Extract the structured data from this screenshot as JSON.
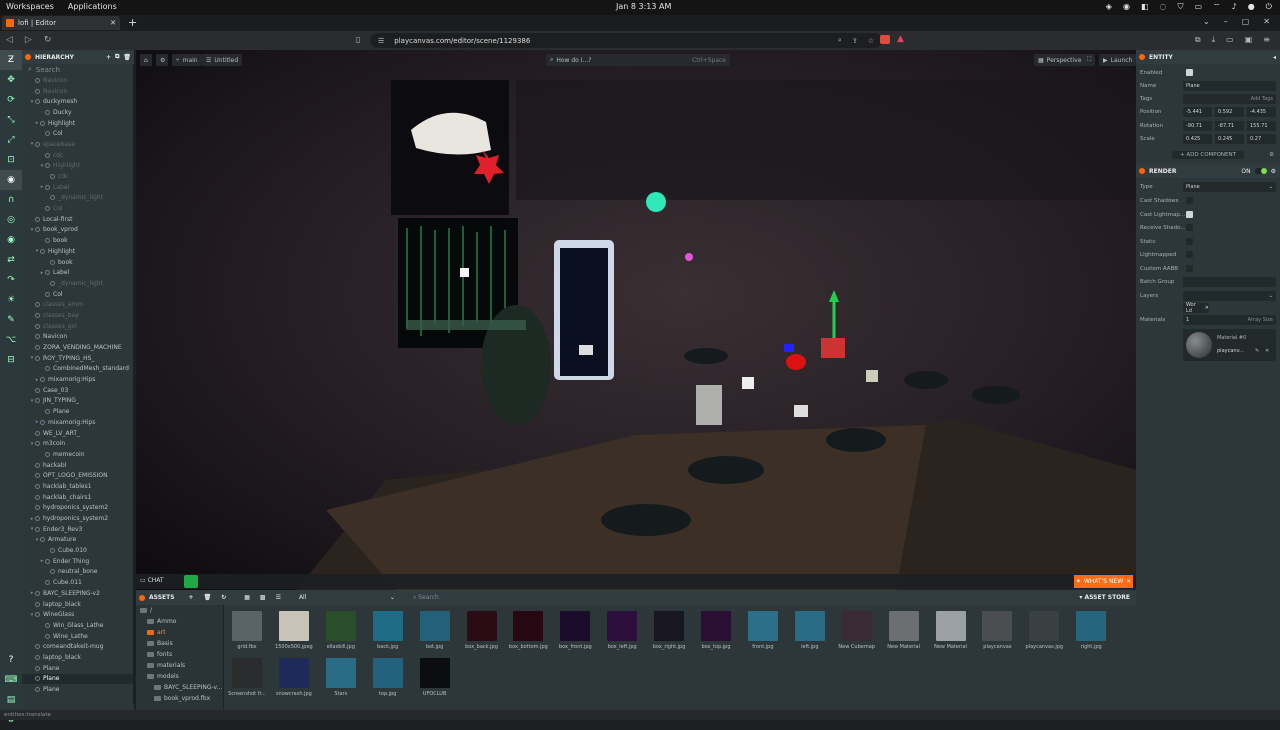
{
  "os": {
    "workspaces": "Workspaces",
    "applications": "Applications",
    "clock": "Jan 8   3:13 AM"
  },
  "browser": {
    "tab_title": "lofi | Editor",
    "url": "playcanvas.com/editor/scene/1129386"
  },
  "toolbar": {
    "branch": "main",
    "scene": "Untitled",
    "howdoi": "How do I...?",
    "howdoi_hint": "Ctrl+Space",
    "perspective": "Perspective",
    "launch": "Launch"
  },
  "hierarchy": {
    "title": "HIERARCHY",
    "search_placeholder": "Search",
    "rows": [
      {
        "label": "Navicon",
        "indent": 1,
        "dim": true,
        "toggle": ""
      },
      {
        "label": "Navicon",
        "indent": 1,
        "dim": true,
        "toggle": ""
      },
      {
        "label": "duckymesh",
        "indent": 1,
        "dim": false,
        "toggle": "-"
      },
      {
        "label": "Ducky",
        "indent": 3,
        "dim": false,
        "toggle": ""
      },
      {
        "label": "Highlight",
        "indent": 2,
        "dim": false,
        "toggle": "+"
      },
      {
        "label": "Col",
        "indent": 3,
        "dim": false,
        "toggle": ""
      },
      {
        "label": "spacebase",
        "indent": 1,
        "dim": true,
        "toggle": "-"
      },
      {
        "label": "cdc",
        "indent": 3,
        "dim": true,
        "toggle": ""
      },
      {
        "label": "Highlight",
        "indent": 3,
        "dim": true,
        "toggle": "-"
      },
      {
        "label": "cdc",
        "indent": 4,
        "dim": true,
        "toggle": ""
      },
      {
        "label": "Label",
        "indent": 3,
        "dim": true,
        "toggle": "+"
      },
      {
        "label": "_dynamic_light",
        "indent": 4,
        "dim": true,
        "toggle": ""
      },
      {
        "label": "Col",
        "indent": 3,
        "dim": true,
        "toggle": ""
      },
      {
        "label": "Local-first",
        "indent": 1,
        "dim": false,
        "toggle": ""
      },
      {
        "label": "book_vprod",
        "indent": 1,
        "dim": false,
        "toggle": "-"
      },
      {
        "label": "book",
        "indent": 3,
        "dim": false,
        "toggle": ""
      },
      {
        "label": "Highlight",
        "indent": 2,
        "dim": false,
        "toggle": "-"
      },
      {
        "label": "book",
        "indent": 4,
        "dim": false,
        "toggle": ""
      },
      {
        "label": "Label",
        "indent": 3,
        "dim": false,
        "toggle": "+"
      },
      {
        "label": "_dynamic_light",
        "indent": 4,
        "dim": true,
        "toggle": ""
      },
      {
        "label": "Col",
        "indent": 3,
        "dim": false,
        "toggle": ""
      },
      {
        "label": "classes_amm",
        "indent": 1,
        "dim": true,
        "toggle": ""
      },
      {
        "label": "classes_bay",
        "indent": 1,
        "dim": true,
        "toggle": ""
      },
      {
        "label": "classes_gol",
        "indent": 1,
        "dim": true,
        "toggle": ""
      },
      {
        "label": "Navicon",
        "indent": 1,
        "dim": false,
        "toggle": ""
      },
      {
        "label": "ZORA_VENDING_MACHINE",
        "indent": 1,
        "dim": false,
        "toggle": ""
      },
      {
        "label": "ROY_TYPING_HS_",
        "indent": 1,
        "dim": false,
        "toggle": "-"
      },
      {
        "label": "CombinedMesh_standard",
        "indent": 3,
        "dim": false,
        "toggle": ""
      },
      {
        "label": "mixamorig:Hips",
        "indent": 2,
        "dim": false,
        "toggle": "+"
      },
      {
        "label": "Case_03",
        "indent": 1,
        "dim": false,
        "toggle": ""
      },
      {
        "label": "JIN_TYPING_",
        "indent": 1,
        "dim": false,
        "toggle": "-"
      },
      {
        "label": "Plane",
        "indent": 3,
        "dim": false,
        "toggle": ""
      },
      {
        "label": "mixamorig:Hips",
        "indent": 2,
        "dim": false,
        "toggle": "+"
      },
      {
        "label": "WE_LV_ART_",
        "indent": 1,
        "dim": false,
        "toggle": ""
      },
      {
        "label": "m3coin",
        "indent": 1,
        "dim": false,
        "toggle": "-"
      },
      {
        "label": "memecoin",
        "indent": 3,
        "dim": false,
        "toggle": ""
      },
      {
        "label": "hackabl",
        "indent": 1,
        "dim": false,
        "toggle": ""
      },
      {
        "label": "OPT_LOGO_EMISSION",
        "indent": 1,
        "dim": false,
        "toggle": ""
      },
      {
        "label": "hacklab_tables1",
        "indent": 1,
        "dim": false,
        "toggle": ""
      },
      {
        "label": "hacklab_chairs1",
        "indent": 1,
        "dim": false,
        "toggle": ""
      },
      {
        "label": "hydroponics_system2",
        "indent": 1,
        "dim": false,
        "toggle": ""
      },
      {
        "label": "hydroponics_system2",
        "indent": 1,
        "dim": false,
        "toggle": "+"
      },
      {
        "label": "Ender3_Rev3",
        "indent": 1,
        "dim": false,
        "toggle": "-"
      },
      {
        "label": "Armature",
        "indent": 2,
        "dim": false,
        "toggle": "-"
      },
      {
        "label": "Cube.010",
        "indent": 4,
        "dim": false,
        "toggle": ""
      },
      {
        "label": "Ender Thing",
        "indent": 3,
        "dim": false,
        "toggle": "+"
      },
      {
        "label": "neutral_bone",
        "indent": 4,
        "dim": false,
        "toggle": ""
      },
      {
        "label": "Cube.011",
        "indent": 3,
        "dim": false,
        "toggle": ""
      },
      {
        "label": "BAYC_SLEEPING-v2",
        "indent": 1,
        "dim": false,
        "toggle": "+"
      },
      {
        "label": "laptop_black",
        "indent": 1,
        "dim": false,
        "toggle": ""
      },
      {
        "label": "WineGlass",
        "indent": 1,
        "dim": false,
        "toggle": "-"
      },
      {
        "label": "Win_Glass_Lathe",
        "indent": 3,
        "dim": false,
        "toggle": ""
      },
      {
        "label": "Wine_Lathe",
        "indent": 3,
        "dim": false,
        "toggle": ""
      },
      {
        "label": "comeandtakeit-mug",
        "indent": 1,
        "dim": false,
        "toggle": ""
      },
      {
        "label": "laptop_black",
        "indent": 1,
        "dim": false,
        "toggle": ""
      },
      {
        "label": "Plane",
        "indent": 1,
        "dim": false,
        "toggle": ""
      },
      {
        "label": "Plane",
        "indent": 1,
        "dim": false,
        "toggle": "",
        "selected": true
      },
      {
        "label": "Plane",
        "indent": 1,
        "dim": false,
        "toggle": ""
      }
    ]
  },
  "assets": {
    "chat": "CHAT",
    "title": "ASSETS",
    "filter": "All",
    "search_placeholder": "Search",
    "asset_store": "ASSET STORE",
    "whats_new": "WHAT'S NEW",
    "tree": [
      {
        "label": "/",
        "indent": 0
      },
      {
        "label": "Ammo",
        "indent": 1
      },
      {
        "label": "art",
        "indent": 1,
        "active": true
      },
      {
        "label": "Basis",
        "indent": 1
      },
      {
        "label": "fonts",
        "indent": 1
      },
      {
        "label": "materials",
        "indent": 1
      },
      {
        "label": "models",
        "indent": 1
      },
      {
        "label": "BAYC_SLEEPING-v...",
        "indent": 2
      },
      {
        "label": "book_vprod.fbx",
        "indent": 2
      }
    ],
    "items": [
      {
        "label": "grid.fbx",
        "color": "#5a6468"
      },
      {
        "label": "1500x500.jpeg",
        "color": "#c9c3b7"
      },
      {
        "label": "ellasbill.jpg",
        "color": "#2a4d2a"
      },
      {
        "label": "back.jpg",
        "color": "#1e6b86"
      },
      {
        "label": "bot.jpg",
        "color": "#23607a"
      },
      {
        "label": "box_back.jpg",
        "color": "#2a0d14"
      },
      {
        "label": "box_bottom.jpg",
        "color": "#260712"
      },
      {
        "label": "box_front.jpg",
        "color": "#1a0c2a"
      },
      {
        "label": "box_left.jpg",
        "color": "#2c0f3c"
      },
      {
        "label": "box_right.jpg",
        "color": "#181620"
      },
      {
        "label": "box_top.jpg",
        "color": "#2a0f32"
      },
      {
        "label": "front.jpg",
        "color": "#2b6f8a"
      },
      {
        "label": "left.jpg",
        "color": "#2a6b86"
      },
      {
        "label": "New Cubemap",
        "color": "#3a2a36"
      },
      {
        "label": "New Material",
        "color": "#6b6f72"
      },
      {
        "label": "New Material",
        "color": "#9aa0a3"
      },
      {
        "label": "playcanvas",
        "color": "#4a4e51"
      },
      {
        "label": "playcanvas.jpg",
        "color": "#3a3f42"
      },
      {
        "label": "right.jpg",
        "color": "#25657e"
      },
      {
        "label": "Screenshot fr...",
        "color": "#2a2c2e"
      },
      {
        "label": "snowcrash.jpg",
        "color": "#1e2a5a"
      },
      {
        "label": "Stars",
        "color": "#2a6b86"
      },
      {
        "label": "top.jpg",
        "color": "#23627e"
      },
      {
        "label": "UFOCLUB",
        "color": "#0c0d0f"
      }
    ]
  },
  "inspector": {
    "entity_title": "ENTITY",
    "enabled_label": "Enabled",
    "name_label": "Name",
    "name_value": "Plane",
    "tags_label": "Tags",
    "add_tags": "Add Tags",
    "position_label": "Position",
    "rotation_label": "Rotation",
    "scale_label": "Scale",
    "position": [
      "-5.441",
      "0.592",
      "-4.435"
    ],
    "rotation": [
      "-90.71",
      "-87.71",
      "155.71"
    ],
    "scale": [
      "0.425",
      "0.245",
      "0.27"
    ],
    "add_component": "ADD COMPONENT",
    "render_title": "RENDER",
    "render_on": "ON",
    "type_label": "Type",
    "type_value": "Plane",
    "cast_shadows": "Cast Shadows",
    "cast_lightmap": "Cast Lightmap...",
    "receive_shadows": "Receive Shado...",
    "static": "Static",
    "lightmapped": "Lightmapped",
    "custom_aabb": "Custom AABB",
    "batch_group": "Batch Group",
    "layers": "Layers",
    "layer_chip": "Wor Ld",
    "materials_label": "Materials",
    "materials_count": "1",
    "array_size": "Array Size",
    "material_slot": "Material #0",
    "material_name": "playcanv..."
  },
  "status": {
    "text": "entities:translate"
  },
  "colors": {
    "brand": "#ff6600",
    "panel": "#2d3739",
    "sidebar": "#2c393c",
    "accent_green": "#7ddc4f"
  }
}
